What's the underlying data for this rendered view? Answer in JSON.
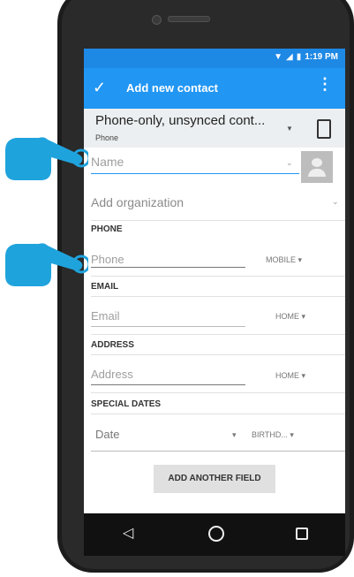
{
  "statusbar": {
    "time": "1:19 PM",
    "icons": [
      "wifi-icon",
      "signal-icon",
      "battery-icon"
    ]
  },
  "toolbar": {
    "title": "Add new contact",
    "save_icon": "check-icon",
    "more_icon": "more-vert-icon"
  },
  "account": {
    "title": "Phone-only, unsynced cont...",
    "subtitle": "Phone",
    "icon": "phone-device-icon"
  },
  "name": {
    "placeholder": "Name"
  },
  "organization": {
    "label": "Add organization"
  },
  "phone": {
    "section": "PHONE",
    "placeholder": "Phone",
    "type": "MOBILE"
  },
  "email": {
    "section": "EMAIL",
    "placeholder": "Email",
    "type": "HOME"
  },
  "address": {
    "section": "ADDRESS",
    "placeholder": "Address",
    "type": "HOME"
  },
  "special_dates": {
    "section": "SPECIAL DATES",
    "placeholder": "Date",
    "type": "BIRTHD..."
  },
  "add_field_button": "ADD ANOTHER FIELD",
  "colors": {
    "accent": "#2196f3",
    "statusbar": "#1e88e5",
    "hand": "#1fa3dd"
  },
  "navbar": {
    "icons": [
      "back-icon",
      "home-icon",
      "recents-icon"
    ]
  }
}
